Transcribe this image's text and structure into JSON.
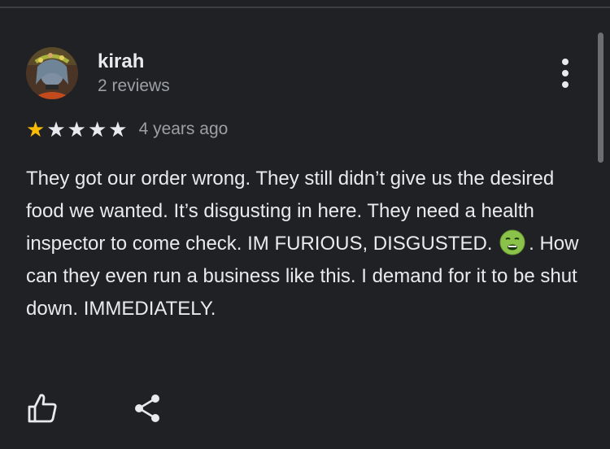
{
  "review": {
    "author": {
      "name": "kirah",
      "meta": "2 reviews",
      "avatar_icon": "profile-photo"
    },
    "rating": {
      "value": 1,
      "max": 5,
      "filled_color": "#fbbc04",
      "empty_color": "#e8eaed"
    },
    "date": "4 years ago",
    "text_before_emoji": "They got our order wrong. They still didn’t give us the desired food we wanted. It’s disgusting in here. They need a health inspector to come check. IM FURIOUS, DISGUSTED.",
    "emoji": "nauseated-face-emoji",
    "text_after_emoji": ". How can they even run a business like this. I demand for it to be shut down. IMMEDIATELY."
  },
  "actions": {
    "like_icon": "thumbs-up-icon",
    "share_icon": "share-icon",
    "more_icon": "more-vert-icon"
  },
  "colors": {
    "background": "#202124",
    "text_primary": "#e8eaed",
    "text_secondary": "#9aa0a6"
  }
}
